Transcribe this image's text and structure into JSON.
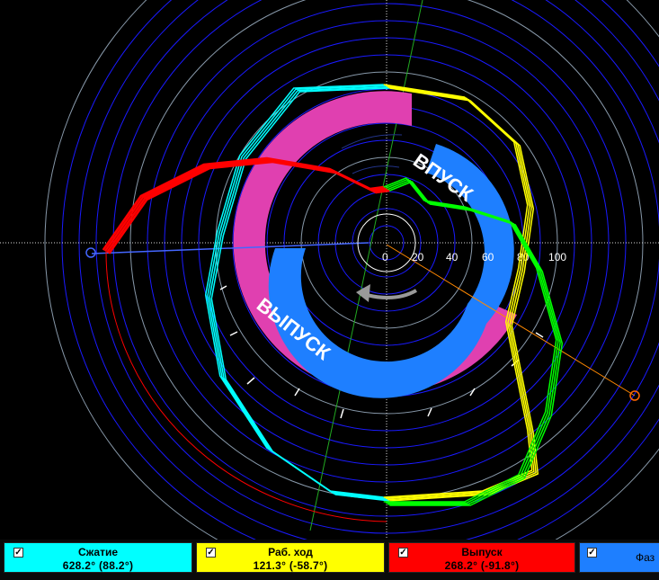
{
  "diagram": {
    "radial_scale_labels": [
      "0",
      "20",
      "40",
      "60",
      "80",
      "100"
    ],
    "intake_label": "ВПУСК",
    "exhaust_label": "ВЫПУСК",
    "colors": {
      "compression": "#00ffff",
      "power_stroke": "#ffff00",
      "exhaust": "#ff0000",
      "intake": "#00ff00",
      "intake_band": "#1e7fff",
      "exhaust_band": "#e040b0",
      "rings": "#1a1aff"
    }
  },
  "status_panels": [
    {
      "name": "Сжатие",
      "value": "628.2° (88.2°)",
      "color": "#00ffff",
      "checked": "✓"
    },
    {
      "name": "Раб. ход",
      "value": "121.3° (-58.7°)",
      "color": "#ffff00",
      "checked": "✓"
    },
    {
      "name": "Выпуск",
      "value": "268.2° (-91.8°)",
      "color": "#ff0000",
      "checked": "✓"
    },
    {
      "name": "Фаз",
      "value": "",
      "color": "#1e7fff",
      "checked": "✓"
    }
  ]
}
